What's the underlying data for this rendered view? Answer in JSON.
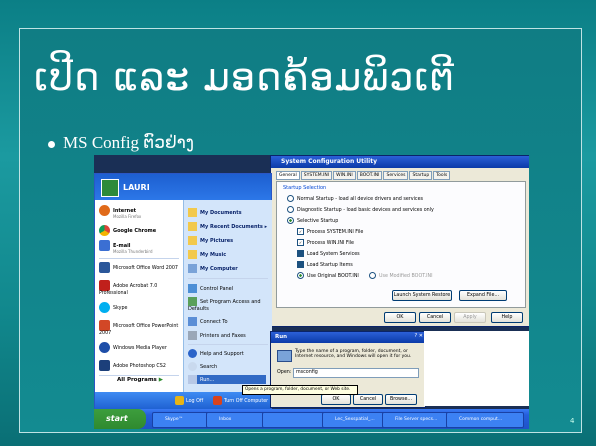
{
  "slide": {
    "title": "ເປີດ ແລະ ມອດຄ້ອມພິວເຕີ",
    "bullet": "MS Config ຕົວຢ່າງ",
    "page_number": "4"
  },
  "msconfig": {
    "title": "System Configuration Utility",
    "tabs": [
      "General",
      "SYSTEM.INI",
      "WIN.INI",
      "BOOT.INI",
      "Services",
      "Startup",
      "Tools"
    ],
    "group_label": "Startup Selection",
    "normal": "Normal Startup - load all device drivers and services",
    "diagnostic": "Diagnostic Startup - load basic devices and services only",
    "selective": "Selective Startup",
    "items": [
      "Process SYSTEM.INI File",
      "Process WIN.INI File",
      "Load System Services",
      "Load Startup Items"
    ],
    "use_original": "Use Original BOOT.INI",
    "use_modified": "Use Modified BOOT.INI",
    "launch_restore": "Launch System Restore",
    "expand_file": "Expand File...",
    "ok": "OK",
    "cancel": "Cancel",
    "apply": "Apply",
    "help": "Help"
  },
  "start_menu": {
    "user": "LAURI",
    "left": [
      {
        "title": "Internet",
        "sub": "Mozilla Firefox"
      },
      {
        "title": "Google Chrome",
        "sub": ""
      },
      {
        "title": "E-mail",
        "sub": "Mozilla Thunderbird"
      },
      {
        "title": "Microsoft Office Word 2007",
        "sub": ""
      },
      {
        "title": "Adobe Acrobat 7.0 Professional",
        "sub": ""
      },
      {
        "title": "Skype",
        "sub": ""
      },
      {
        "title": "Microsoft Office PowerPoint 2007",
        "sub": ""
      },
      {
        "title": "Windows Media Player",
        "sub": ""
      },
      {
        "title": "Adobe Photoshop CS2",
        "sub": ""
      }
    ],
    "right": [
      "My Documents",
      "My Recent Documents",
      "My Pictures",
      "My Music",
      "My Computer",
      "Control Panel",
      "Set Program Access and Defaults",
      "Connect To",
      "Printers and Faxes",
      "Help and Support",
      "Search",
      "Run..."
    ],
    "all_programs": "All Programs",
    "log_off": "Log Off",
    "turn_off": "Turn Off Computer"
  },
  "run_dialog": {
    "title": "Run",
    "description": "Type the name of a program, folder, document, or Internet resource, and Windows will open it for you.",
    "open_label": "Open:",
    "open_value": "msconfig",
    "ok": "OK",
    "cancel": "Cancel",
    "browse": "Browse..."
  },
  "tooltip": "Opens a program, folder, document, or Web site.",
  "taskbar": {
    "start": "start",
    "tasks": [
      "Skype™",
      "Inbox",
      "",
      "Lec_Sexspatial_...",
      "File Server specs...",
      "Common comput..."
    ]
  }
}
